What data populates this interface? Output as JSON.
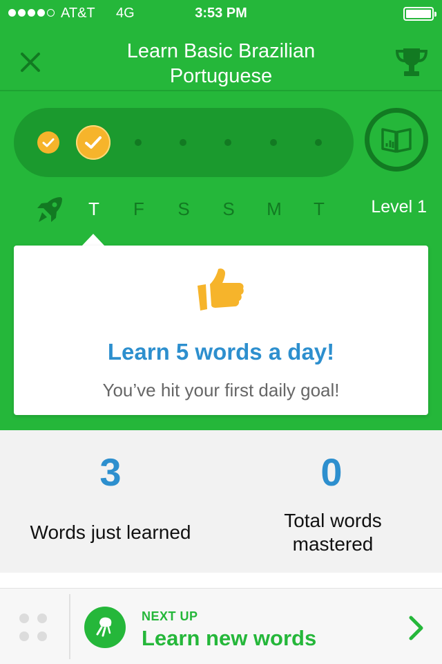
{
  "status_bar": {
    "carrier": "AT&T",
    "network": "4G",
    "time": "3:53 PM",
    "signal_bars_filled": 4,
    "signal_bars_total": 5,
    "battery_level": 1.0
  },
  "header": {
    "title_line1": "Learn Basic Brazilian",
    "title_line2": "Portuguese",
    "close_icon": "close-icon",
    "trophy_icon": "trophy-icon"
  },
  "progress": {
    "completed_days": 2,
    "total_days": 7,
    "book_icon": "book-icon"
  },
  "week": {
    "rocket_icon": "rocket-icon",
    "days": [
      "T",
      "F",
      "S",
      "S",
      "M",
      "T"
    ],
    "active_index": 0,
    "level_label": "Level 1"
  },
  "popup": {
    "icon": "thumbs-up-icon",
    "title": "Learn 5 words a day!",
    "subtitle": "You’ve hit your first daily goal!"
  },
  "stats": {
    "learned_value": "3",
    "learned_label": "Words just learned",
    "mastered_value": "0",
    "mastered_label_line1": "Total words",
    "mastered_label_line2": "mastered"
  },
  "bottom_bar": {
    "next_up_label": "NEXT UP",
    "next_title": "Learn new words",
    "next_icon": "plant-icon",
    "arrow_icon": "chevron-right-icon"
  },
  "colors": {
    "primary_green": "#25b73a",
    "dark_green": "#127a22",
    "track_green": "#1b9a2e",
    "accent_blue": "#2d8fce",
    "gold": "#f6b42b"
  }
}
